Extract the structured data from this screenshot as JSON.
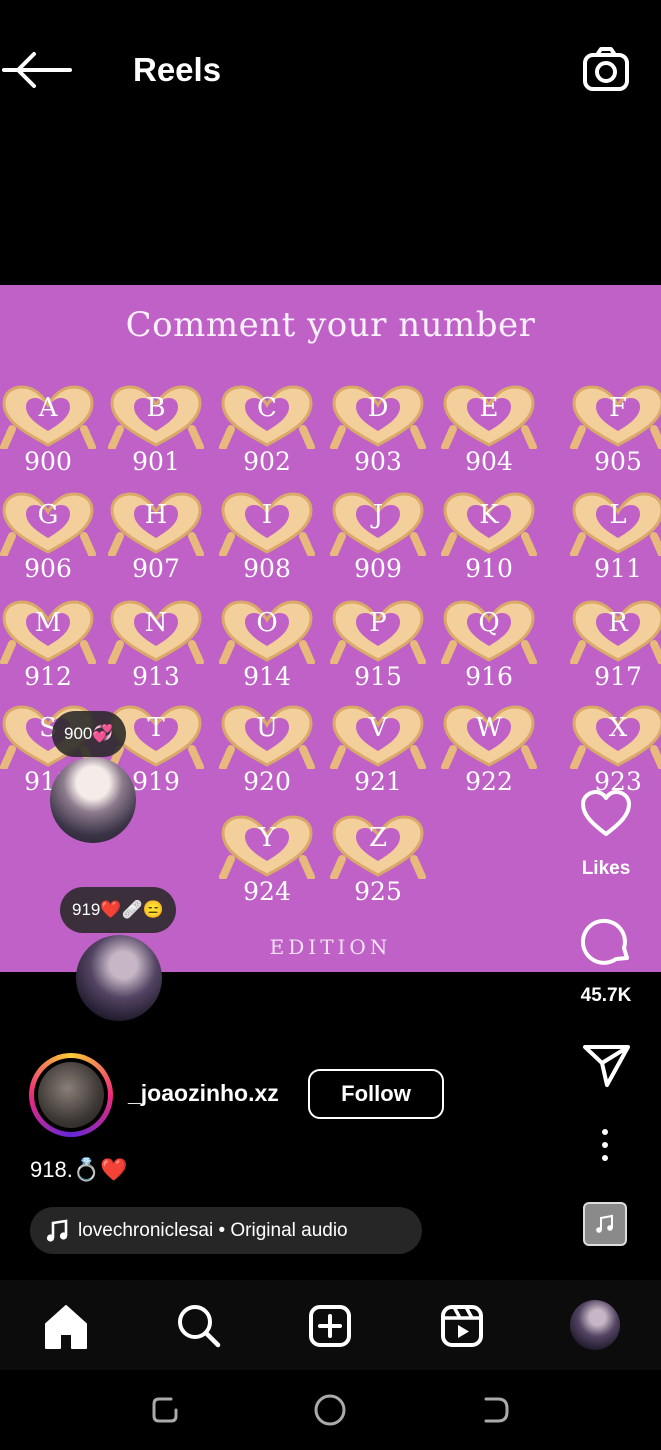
{
  "header": {
    "title": "Reels",
    "back_icon": "arrow-left-icon",
    "camera_icon": "camera-icon"
  },
  "reel": {
    "title": "Comment your number",
    "footer": "EDITION",
    "background": "#bf61c6",
    "grid": [
      {
        "letter": "A",
        "number": "900"
      },
      {
        "letter": "B",
        "number": "901"
      },
      {
        "letter": "C",
        "number": "902"
      },
      {
        "letter": "D",
        "number": "903"
      },
      {
        "letter": "E",
        "number": "904"
      },
      {
        "letter": "F",
        "number": "905"
      },
      {
        "letter": "G",
        "number": "906"
      },
      {
        "letter": "H",
        "number": "907"
      },
      {
        "letter": "I",
        "number": "908"
      },
      {
        "letter": "J",
        "number": "909"
      },
      {
        "letter": "K",
        "number": "910"
      },
      {
        "letter": "L",
        "number": "911"
      },
      {
        "letter": "M",
        "number": "912"
      },
      {
        "letter": "N",
        "number": "913"
      },
      {
        "letter": "O",
        "number": "914"
      },
      {
        "letter": "P",
        "number": "915"
      },
      {
        "letter": "Q",
        "number": "916"
      },
      {
        "letter": "R",
        "number": "917"
      },
      {
        "letter": "S",
        "number": "918"
      },
      {
        "letter": "T",
        "number": "919"
      },
      {
        "letter": "U",
        "number": "920"
      },
      {
        "letter": "V",
        "number": "921"
      },
      {
        "letter": "W",
        "number": "922"
      },
      {
        "letter": "X",
        "number": "923"
      },
      {
        "letter": "Y",
        "number": "924"
      },
      {
        "letter": "Z",
        "number": "925"
      }
    ]
  },
  "floating_comments": [
    {
      "text": "900💞"
    },
    {
      "text": "919❤️🩹😑"
    }
  ],
  "actions": {
    "likes_label": "Likes",
    "comments_count": "45.7K"
  },
  "author": {
    "username": "_joaozinho.xz",
    "follow_label": "Follow"
  },
  "caption": "918.💍❤️",
  "audio": {
    "text": "lovechroniclesai • Original audio"
  },
  "nav": {
    "items": [
      "home-icon",
      "search-icon",
      "create-icon",
      "reels-icon",
      "profile-avatar"
    ]
  }
}
